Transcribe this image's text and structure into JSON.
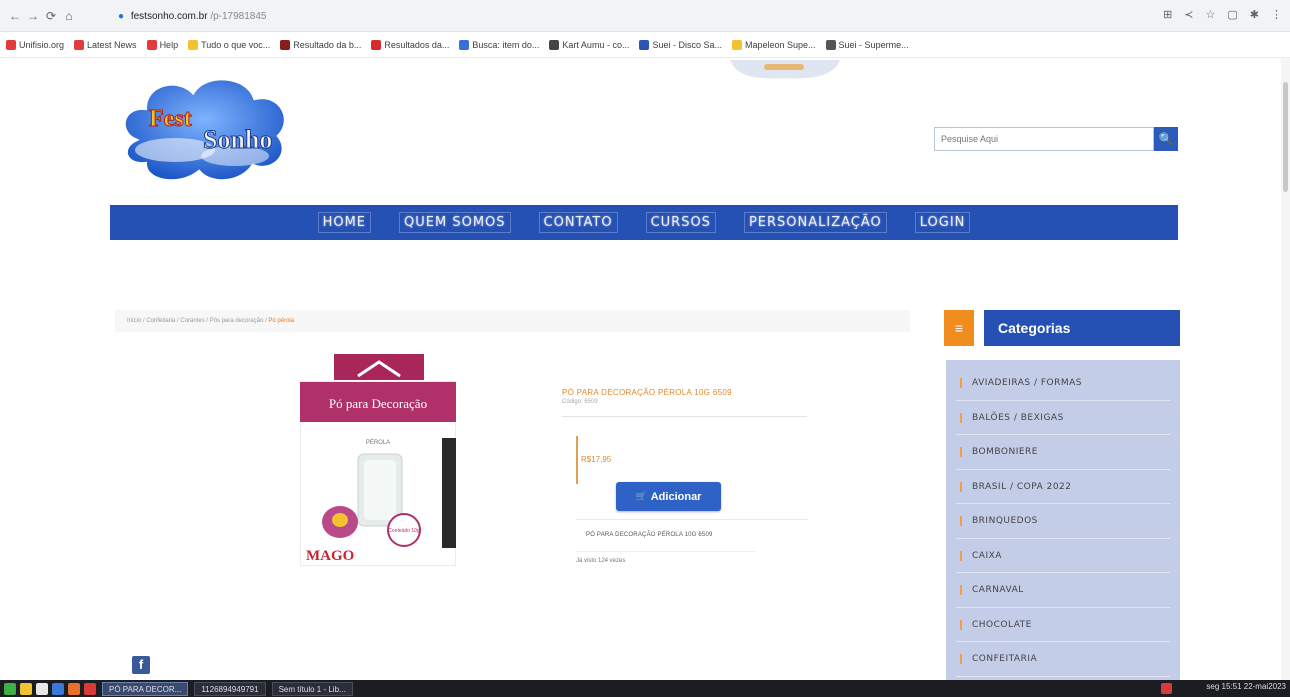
{
  "browser": {
    "url_host": "festsonho.com.br",
    "url_path": "/p-17981845",
    "nav_back": "←",
    "nav_forward": "→",
    "nav_reload": "⟳",
    "nav_home": "⌂",
    "bookmarks": [
      {
        "label": "Unifisio.org",
        "color": "#e23b3b"
      },
      {
        "label": "Latest News",
        "color": "#e23b3b"
      },
      {
        "label": "Help",
        "color": "#e23b3b"
      },
      {
        "label": "Tudo o que voc...",
        "color": "#f2c230"
      },
      {
        "label": "Resultado da b...",
        "color": "#8a1c1c"
      },
      {
        "label": "Resultados da...",
        "color": "#d62b2b"
      },
      {
        "label": "Busca: item do...",
        "color": "#3a6fd8"
      },
      {
        "label": "Kart Aumu - co...",
        "color": "#444444"
      },
      {
        "label": "Suei - Disco Sa...",
        "color": "#2a55b0"
      },
      {
        "label": "Mapeleon Supe...",
        "color": "#f2c230"
      },
      {
        "label": "Suei - Superme...",
        "color": "#555555"
      }
    ]
  },
  "site": {
    "logo_text_1": "Fest",
    "logo_text_2": "Sonho",
    "search_placeholder": "Pesquise Aqui",
    "search_button": "🔍",
    "nav": [
      "HOME",
      "QUEM SOMOS",
      "CONTATO",
      "CURSOS",
      "PERSONALIZAÇÃO",
      "LOGIN"
    ]
  },
  "breadcrumb": {
    "path": "Início / Confeitaria / Corantes / Pós para decoração /",
    "current": "Pó pérola"
  },
  "product": {
    "image_label": "Pó para Decoração",
    "image_sublabel": "PÉROLA",
    "image_brand": "MAGO",
    "image_weight": "Conteúdo 10g",
    "title": "PÓ PARA DECORAÇÃO PÉROLA 10G 6509",
    "subtitle": "Código: 6509",
    "price": "R$17,95",
    "add_button_icon": "🛒",
    "add_button": "Adicionar",
    "description": "PÓ PARA DECORAÇÃO PÉROLA 10G 6509",
    "views": "Já visto 124 vezes"
  },
  "sidebar": {
    "menu_icon": "≡",
    "title": "Categorias",
    "items": [
      "AVIADEIRAS / FORMAS",
      "BALÕES / BEXIGAS",
      "BOMBONIERE",
      "BRASIL / COPA 2022",
      "BRINQUEDOS",
      "CAIXA",
      "CARNAVAL",
      "CHOCOLATE",
      "CONFEITARIA"
    ]
  },
  "social": {
    "facebook_icon": "f"
  },
  "taskbar": {
    "tasks": [
      "PÓ PARA DECOR...",
      "1126894949791",
      "Sem título 1 - Lib..."
    ],
    "clock": "seg 15:51 22-mai2023"
  }
}
